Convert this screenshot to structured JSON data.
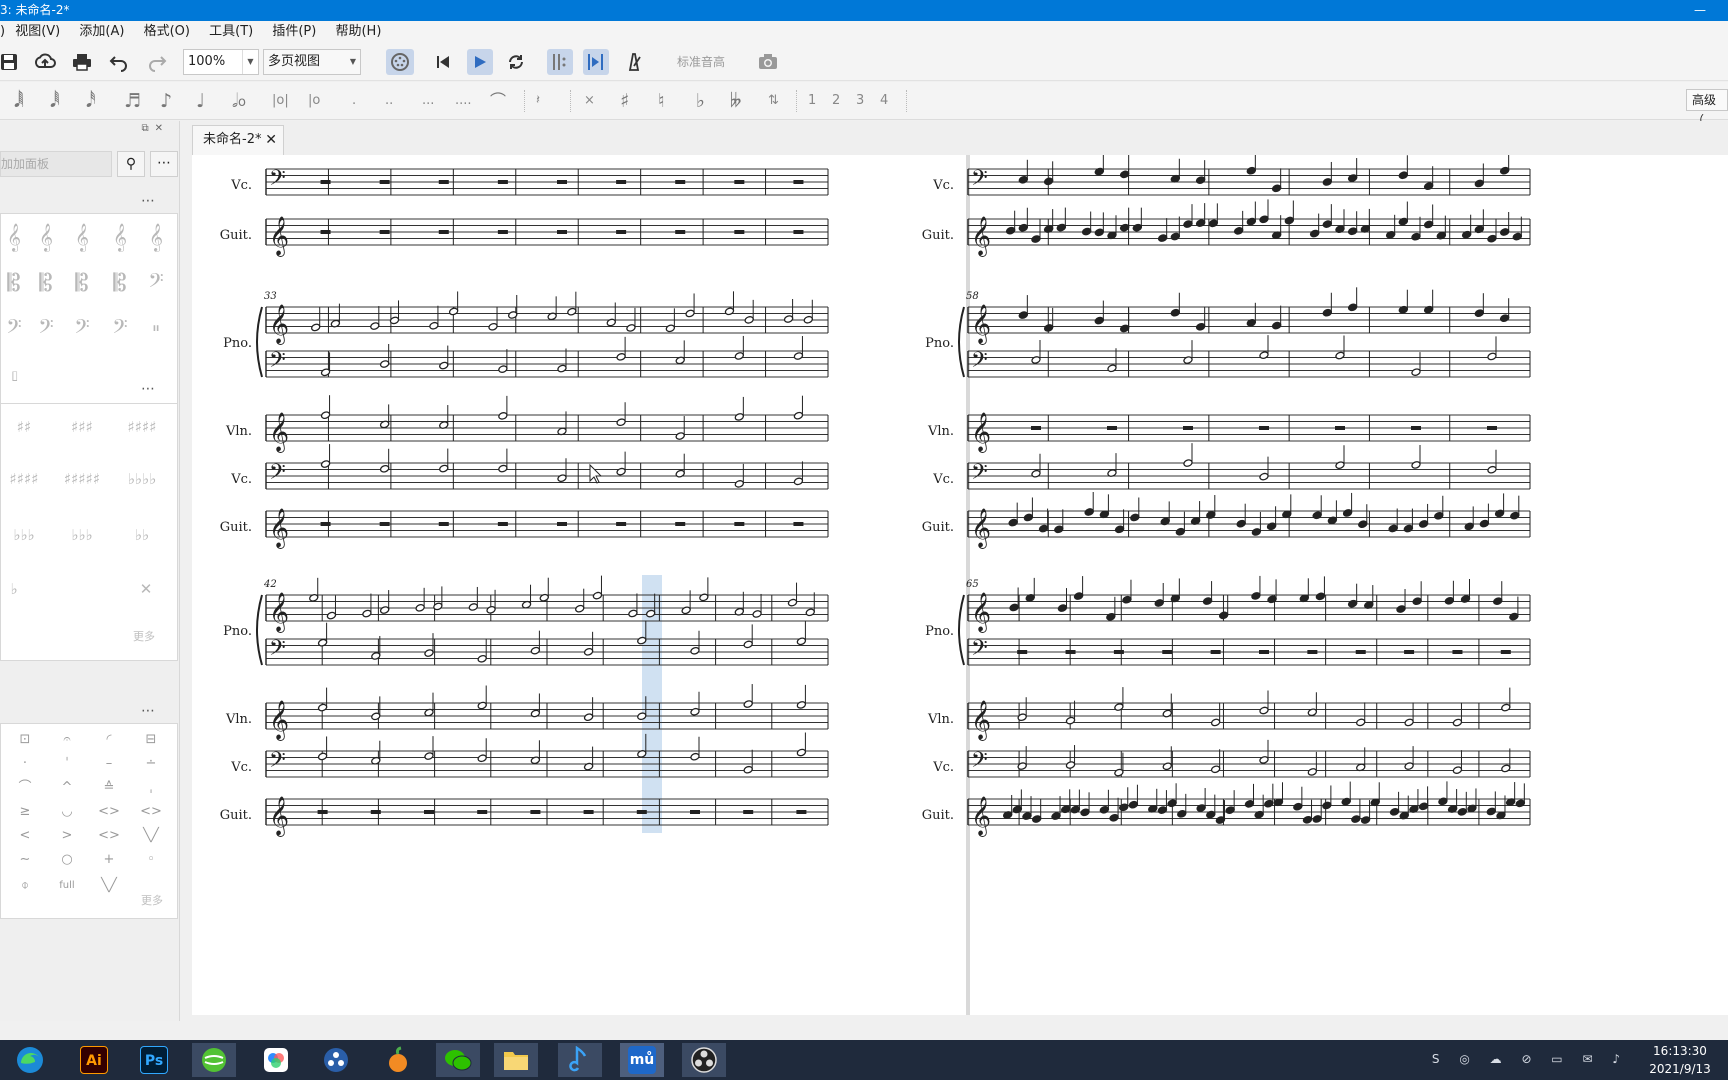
{
  "window": {
    "title": "3: 未命名-2*"
  },
  "menu": {
    "items": [
      ")",
      "视图(V)",
      "添加(A)",
      "格式(O)",
      "工具(T)",
      "插件(P)",
      "帮助(H)"
    ]
  },
  "toolbar": {
    "zoom": "100%",
    "view_mode": "多页视图",
    "tuning_label": "标准音高",
    "icons": [
      "save-icon",
      "upload-icon",
      "print-icon",
      "undo-icon",
      "redo-icon",
      "midi-input-icon",
      "rewind-icon",
      "play-icon",
      "loop-icon",
      "play-repeats-icon",
      "pan-icon",
      "metronome-icon",
      "camera-icon"
    ]
  },
  "note_toolbar": {
    "voices": [
      "1",
      "2",
      "3",
      "4"
    ],
    "advanced_label": "高级（"
  },
  "palette": {
    "search_placeholder": "加加面板",
    "more_label": "更多"
  },
  "document_tab": {
    "title": "未命名-2*"
  },
  "score": {
    "page1": {
      "systems": [
        {
          "measure_number": "",
          "staves": [
            "Vc.",
            "Guit."
          ]
        },
        {
          "measure_number": "33",
          "staves": [
            "Pno.",
            "Vln.",
            "Vc.",
            "Guit."
          ]
        },
        {
          "measure_number": "42",
          "staves": [
            "Pno.",
            "Vln.",
            "Vc.",
            "Guit."
          ]
        }
      ]
    },
    "page2": {
      "systems": [
        {
          "measure_number": "",
          "staves": [
            "Vc.",
            "Guit."
          ]
        },
        {
          "measure_number": "58",
          "staves": [
            "Pno.",
            "Vln.",
            "Vc.",
            "Guit."
          ]
        },
        {
          "measure_number": "65",
          "staves": [
            "Pno.",
            "Vln.",
            "Vc.",
            "Guit."
          ]
        }
      ]
    },
    "selection_color": "#a9c9e8"
  },
  "taskbar": {
    "apps": [
      "edge",
      "Ai",
      "Ps",
      "360",
      "baidu-netdisk",
      "davinci",
      "fl-studio",
      "wechat",
      "file-explorer",
      "music-app",
      "musescore",
      "obs"
    ],
    "clock_time": "16:13:30",
    "clock_date": "2021/9/13"
  },
  "colors": {
    "titlebar": "#0078d7",
    "taskbar": "#1f2a3c",
    "accent": "#2f6cc0"
  }
}
